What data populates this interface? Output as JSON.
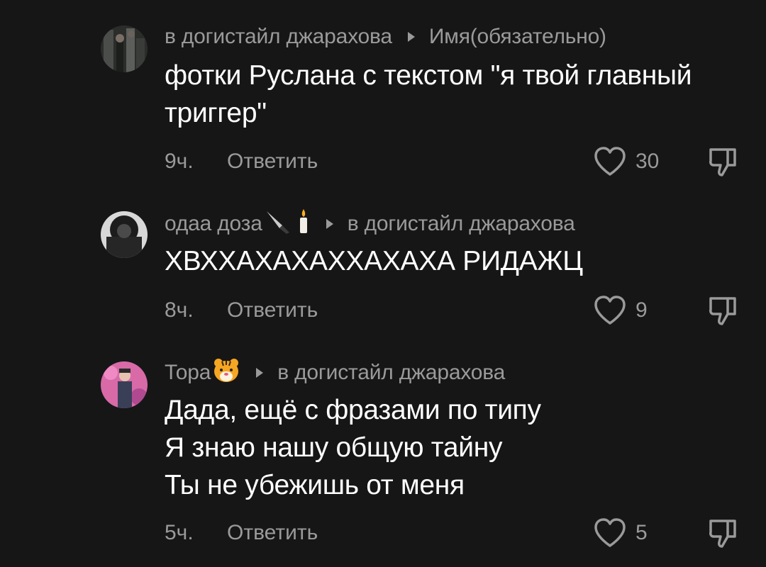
{
  "comments": [
    {
      "author": "в догистайл джарахова",
      "reply_to": "Имя(обязательно)",
      "text": "фотки Руслана с текстом \"я твой главный\nтриггер\"",
      "time": "9ч.",
      "reply_label": "Ответить",
      "likes": "30",
      "avatar_color": "#3a3a3a"
    },
    {
      "author": "одаа доза",
      "author_emoji": [
        "knife-emoji",
        "candle-emoji"
      ],
      "reply_to": "в догистайл джарахова",
      "text": "ХВХХАХАХАХХАХАХА РИДАЖЦ",
      "time": "8ч.",
      "reply_label": "Ответить",
      "likes": "9",
      "avatar_color": "#2a2a2a"
    },
    {
      "author": "Тора",
      "author_emoji": [
        "tiger-face-emoji"
      ],
      "reply_to": "в догистайл джарахова",
      "text": "Дада, ещё с фразами по типу\nЯ знаю нашу общую тайну\nТы не убежишь от меня",
      "time": "5ч.",
      "reply_label": "Ответить",
      "likes": "5",
      "avatar_color": "#d86aa8"
    }
  ],
  "icons": {
    "like": "heart-outline-icon",
    "dislike": "thumbs-down-outline-icon",
    "reply_arrow": "play-arrow-icon"
  },
  "colors": {
    "background": "#161616",
    "secondary_text": "#9a9a9a",
    "primary_text": "#ffffff"
  }
}
